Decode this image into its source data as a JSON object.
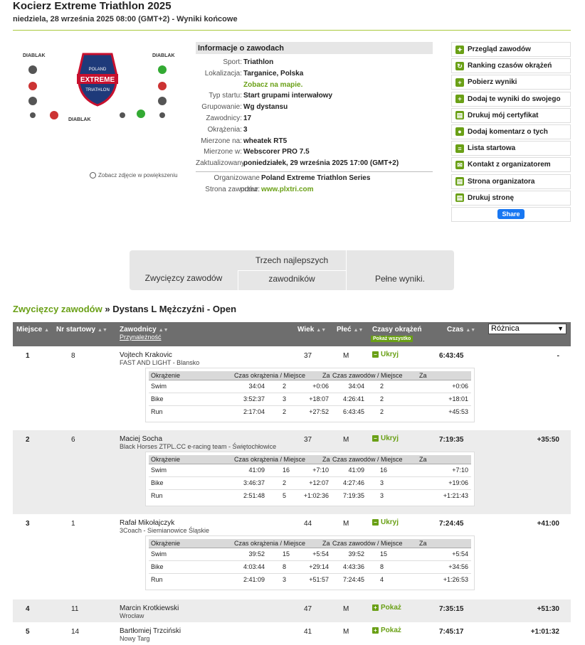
{
  "header": {
    "title": "Kocierz Extreme Triathlon 2025",
    "subtitle": "niedziela, 28 września 2025 08:00 (GMT+2) - Wyniki końcowe"
  },
  "image": {
    "zoom_label": "Zobacz zdjęcie w powiększeniu",
    "logo_text": "DIABLAK",
    "badge_text": "EXTREME",
    "badge_top": "POLAND",
    "badge_bottom": "TRIATHLON"
  },
  "info": {
    "heading": "Informacje o zawodach",
    "rows": [
      {
        "label": "Sport:",
        "value": "Triathlon"
      },
      {
        "label": "Lokalizacja:",
        "value": "Targanice, Polska"
      },
      {
        "label": "",
        "value": "Zobacz na mapie."
      },
      {
        "label": "Typ startu:",
        "value": "Start grupami interwałowy"
      },
      {
        "label": "Grupowanie:",
        "value": "Wg dystansu"
      },
      {
        "label": "Zawodnicy:",
        "value": "17"
      },
      {
        "label": "Okrążenia:",
        "value": "3"
      },
      {
        "label": "Mierzone na:",
        "value": "wheatek RT5"
      },
      {
        "label": "Mierzone w:",
        "value": "Webscorer PRO 7.5"
      },
      {
        "label": "Zaktualizowany:",
        "value": "poniedziałek, 29 września 2025 17:00 (GMT+2)"
      }
    ],
    "org_label": "Organizowane przez:",
    "org_value": "Poland Extreme Triathlon Series",
    "site_label": "Strona zawodów:",
    "site_value": "www.plxtri.com"
  },
  "actions": [
    {
      "label": "Przegląd zawodów",
      "icon": "runner-icon"
    },
    {
      "label": "Ranking czasów okrążeń",
      "icon": "refresh-icon"
    },
    {
      "label": "Pobierz wyniki",
      "icon": "download-icon"
    },
    {
      "label": "Dodaj te wyniki do swojego",
      "icon": "plus-icon"
    },
    {
      "label": "Drukuj mój certyfikat",
      "icon": "print-icon"
    },
    {
      "label": "Dodaj komentarz o tych",
      "icon": "comment-icon"
    },
    {
      "label": "Lista startowa",
      "icon": "list-icon"
    },
    {
      "label": "Kontakt z organizatorem",
      "icon": "mail-icon"
    },
    {
      "label": "Strona organizatora",
      "icon": "page-icon"
    },
    {
      "label": "Drukuj stronę",
      "icon": "print-icon"
    }
  ],
  "share_label": "Share",
  "tabs": {
    "winners": "Zwycięzcy zawodów",
    "top3_line1": "Trzech najlepszych",
    "top3_line2": "zawodników",
    "full": "Pełne wyniki."
  },
  "breadcrumb": {
    "link": "Zwycięzcy zawodów",
    "sep": "»",
    "current": "Dystans L Mężczyźni - Open"
  },
  "table_head": {
    "place": "Miejsce",
    "bib": "Nr startowy",
    "name": "Zawodnicy",
    "affil": "Przynależność",
    "age": "Wiek",
    "gender": "Płeć",
    "laps": "Czasy okrążeń",
    "show_all": "Pokaż wszystko",
    "time": "Czas",
    "diff": "Różnica"
  },
  "lap_head": {
    "lap": "Okrążenie",
    "lap_time": "Czas okrążenia / Miejsce",
    "za1": "Za",
    "race_time": "Czas zawodów / Miejsce",
    "za2": "Za"
  },
  "results": [
    {
      "place": "1",
      "bib": "8",
      "name": "Vojtech Krakovic",
      "team": "FAST AND LIGHT - Blansko",
      "age": "37",
      "gender": "M",
      "toggle": "Ukryj",
      "time": "6:43:45",
      "diff": "-",
      "laps": [
        {
          "lap": "Swim",
          "t": "34:04",
          "p": "2",
          "za": "+0:06",
          "rt": "34:04",
          "rp": "2",
          "rza": "+0:06"
        },
        {
          "lap": "Bike",
          "t": "3:52:37",
          "p": "3",
          "za": "+18:07",
          "rt": "4:26:41",
          "rp": "2",
          "rza": "+18:01"
        },
        {
          "lap": "Run",
          "t": "2:17:04",
          "p": "2",
          "za": "+27:52",
          "rt": "6:43:45",
          "rp": "2",
          "rza": "+45:53"
        }
      ]
    },
    {
      "place": "2",
      "bib": "6",
      "name": "Maciej Socha",
      "team": "Black Horses ZTPL.CC e-racing team - Świętochłowice",
      "age": "37",
      "gender": "M",
      "toggle": "Ukryj",
      "time": "7:19:35",
      "diff": "+35:50",
      "laps": [
        {
          "lap": "Swim",
          "t": "41:09",
          "p": "16",
          "za": "+7:10",
          "rt": "41:09",
          "rp": "16",
          "rza": "+7:10"
        },
        {
          "lap": "Bike",
          "t": "3:46:37",
          "p": "2",
          "za": "+12:07",
          "rt": "4:27:46",
          "rp": "3",
          "rza": "+19:06"
        },
        {
          "lap": "Run",
          "t": "2:51:48",
          "p": "5",
          "za": "+1:02:36",
          "rt": "7:19:35",
          "rp": "3",
          "rza": "+1:21:43"
        }
      ]
    },
    {
      "place": "3",
      "bib": "1",
      "name": "Rafał Mikołajczyk",
      "team": "3Coach - Siemianowice Śląskie",
      "age": "44",
      "gender": "M",
      "toggle": "Ukryj",
      "time": "7:24:45",
      "diff": "+41:00",
      "laps": [
        {
          "lap": "Swim",
          "t": "39:52",
          "p": "15",
          "za": "+5:54",
          "rt": "39:52",
          "rp": "15",
          "rza": "+5:54"
        },
        {
          "lap": "Bike",
          "t": "4:03:44",
          "p": "8",
          "za": "+29:14",
          "rt": "4:43:36",
          "rp": "8",
          "rza": "+34:56"
        },
        {
          "lap": "Run",
          "t": "2:41:09",
          "p": "3",
          "za": "+51:57",
          "rt": "7:24:45",
          "rp": "4",
          "rza": "+1:26:53"
        }
      ]
    },
    {
      "place": "4",
      "bib": "11",
      "name": "Marcin Krotkiewski",
      "team": "Wrocław",
      "age": "47",
      "gender": "M",
      "toggle": "Pokaż",
      "time": "7:35:15",
      "diff": "+51:30",
      "laps": []
    },
    {
      "place": "5",
      "bib": "14",
      "name": "Bartłomiej Trzciński",
      "team": "Nowy Targ",
      "age": "41",
      "gender": "M",
      "toggle": "Pokaż",
      "time": "7:45:17",
      "diff": "+1:01:32",
      "laps": []
    }
  ]
}
